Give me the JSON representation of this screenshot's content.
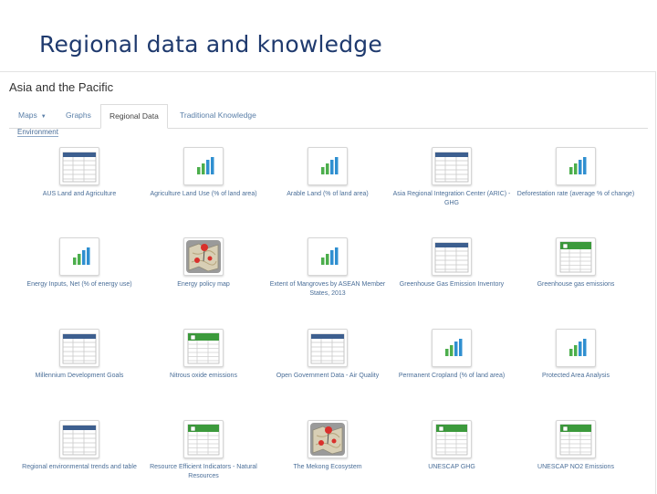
{
  "slide_title": "Regional data and knowledge",
  "app": {
    "title": "Asia and the Pacific"
  },
  "tabs": [
    {
      "label": "Maps",
      "has_dropdown": true
    },
    {
      "label": "Graphs"
    },
    {
      "label": "Regional Data",
      "active": true
    },
    {
      "label": "Traditional Knowledge"
    }
  ],
  "section": "Environment",
  "items": [
    {
      "label": "AUS Land and Agriculture",
      "icon": "table-icon"
    },
    {
      "label": "Agriculture Land Use (% of land area)",
      "icon": "bar-chart-icon"
    },
    {
      "label": "Arable Land (% of land area)",
      "icon": "bar-chart-icon"
    },
    {
      "label": "Asia Regional Integration Center (ARIC) - GHG",
      "icon": "table-icon"
    },
    {
      "label": "Deforestation rate (average % of change)",
      "icon": "bar-chart-icon"
    },
    {
      "label": "Energy Inputs, Net (% of energy use)",
      "icon": "bar-chart-icon"
    },
    {
      "label": "Energy policy map",
      "icon": "map-pin-icon"
    },
    {
      "label": "Extent of Mangroves by ASEAN Member States, 2013",
      "icon": "bar-chart-icon"
    },
    {
      "label": "Greenhouse Gas Emission Inventory",
      "icon": "table-icon"
    },
    {
      "label": "Greenhouse gas emissions",
      "icon": "spreadsheet-icon"
    },
    {
      "label": "Millennium Development Goals",
      "icon": "table-icon"
    },
    {
      "label": "Nitrous oxide emissions",
      "icon": "spreadsheet-icon"
    },
    {
      "label": "Open Government Data - Air Quality",
      "icon": "table-icon"
    },
    {
      "label": "Permanent Cropland (% of land area)",
      "icon": "bar-chart-icon"
    },
    {
      "label": "Protected Area Analysis",
      "icon": "bar-chart-icon"
    },
    {
      "label": "Regional environmental trends and table",
      "icon": "table-icon"
    },
    {
      "label": "Resource Efficient Indicators - Natural Resources",
      "icon": "spreadsheet-icon"
    },
    {
      "label": "The Mekong Ecosystem",
      "icon": "map-pin-icon"
    },
    {
      "label": "UNESCAP GHG",
      "icon": "spreadsheet-icon"
    },
    {
      "label": "UNESCAP NO2 Emissions",
      "icon": "spreadsheet-icon"
    }
  ],
  "colors": {
    "title": "#1f3a6e",
    "link": "#4a6e98",
    "table_header": "#3d5f8f",
    "sheet_header": "#3c9a3c",
    "bar_green": "#4cae4c",
    "bar_blue": "#2f8fd0",
    "map_pin": "#d9302c"
  }
}
